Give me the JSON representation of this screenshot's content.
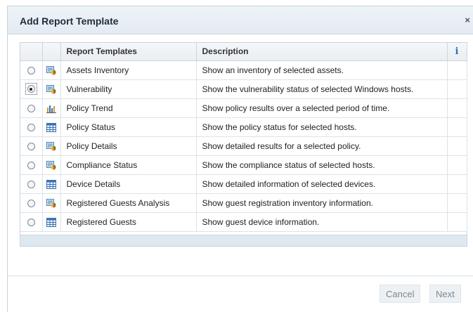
{
  "dialog": {
    "title": "Add Report Template",
    "close_glyph": "×"
  },
  "table": {
    "headers": {
      "report_templates": "Report Templates",
      "description": "Description",
      "info_glyph": "i"
    },
    "rows": [
      {
        "name": "Assets Inventory",
        "description": "Show an inventory of selected assets.",
        "icon": "report-chart-icon",
        "selected": false
      },
      {
        "name": "Vulnerability",
        "description": "Show the vulnerability status of selected Windows hosts.",
        "icon": "report-chart-icon",
        "selected": true
      },
      {
        "name": "Policy Trend",
        "description": "Show policy results over a selected period of time.",
        "icon": "bar-chart-icon",
        "selected": false
      },
      {
        "name": "Policy Status",
        "description": "Show the policy status for selected hosts.",
        "icon": "table-icon",
        "selected": false
      },
      {
        "name": "Policy Details",
        "description": "Show detailed results for a selected policy.",
        "icon": "report-chart-icon",
        "selected": false
      },
      {
        "name": "Compliance Status",
        "description": "Show the compliance status of selected hosts.",
        "icon": "report-chart-icon",
        "selected": false
      },
      {
        "name": "Device Details",
        "description": "Show detailed information of selected devices.",
        "icon": "table-icon",
        "selected": false
      },
      {
        "name": "Registered Guests Analysis",
        "description": "Show guest registration inventory information.",
        "icon": "report-chart-icon",
        "selected": false
      },
      {
        "name": "Registered Guests",
        "description": "Show guest device information.",
        "icon": "table-icon",
        "selected": false
      }
    ]
  },
  "buttons": {
    "cancel": "Cancel",
    "next": "Next"
  }
}
